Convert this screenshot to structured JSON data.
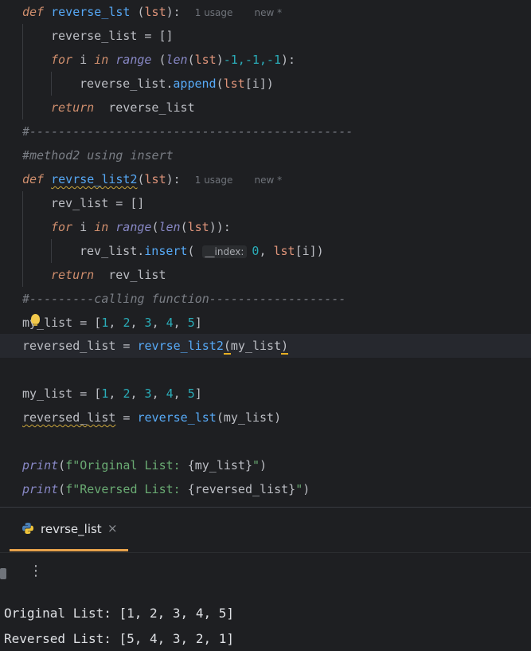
{
  "code": {
    "def_kw": "def",
    "for_kw": "for",
    "in_kw": "in",
    "return_kw": "return",
    "fn1_name": "reverse_lst",
    "fn1_param": "lst",
    "usage_hint": "1 usage",
    "new_hint": "new *",
    "reverse_list_var": "reverse_list",
    "empty_list": "[]",
    "i_var": "i",
    "range_fn": "range",
    "len_fn": "len",
    "range_args_tail": "-1,-1,-1",
    "append_method": "append",
    "sep_comment": "#---------------------------------------------",
    "method2_comment": "#method2 using insert",
    "fn2_name": "revrse_list2",
    "rev_list_var": "rev_list",
    "insert_method": "insert",
    "index_hint": "__index:",
    "zero": "0",
    "calling_comment": "#---------calling function-------------------",
    "my_list_var": "my_list",
    "nums": [
      "1",
      "2",
      "3",
      "4",
      "5"
    ],
    "reversed_list_var": "reversed_list",
    "print_fn": "print",
    "fstr1_prefix": "f\"Original List: ",
    "fstr2_prefix": "f\"Reversed List: ",
    "fstr_end": "\""
  },
  "tool_window": {
    "tab_label": "revrse_list",
    "close_glyph": "×",
    "more_glyph": "⋮"
  },
  "console": {
    "lines": [
      "Original List: [1, 2, 3, 4, 5]",
      "Reversed List: [5, 4, 3, 2, 1]"
    ]
  },
  "colors": {
    "background": "#1e1f22",
    "keyword": "#cf8e6d",
    "function": "#56a8f5",
    "number": "#2aacb8",
    "string": "#6aab73",
    "comment": "#7a7e85",
    "tab_accent": "#e6a14b"
  },
  "icons": {
    "tab_icon": "python-icon",
    "intention": "lightbulb-icon",
    "stop": "stop-icon",
    "more": "more-vertical-icon",
    "close": "close-icon"
  }
}
